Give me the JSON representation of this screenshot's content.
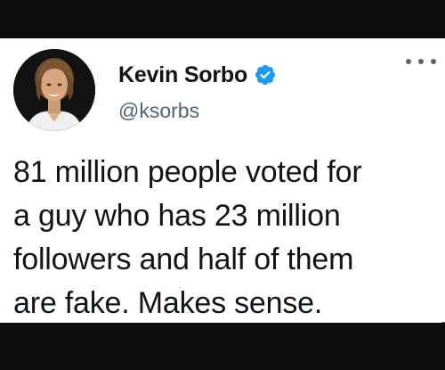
{
  "tweet": {
    "author": {
      "display_name": "Kevin Sorbo",
      "handle": "@ksorbs",
      "verified": true,
      "avatar_icon": "profile-photo"
    },
    "text_lines": [
      "81 million people voted for",
      "a guy who has 23 million",
      "followers and half of them",
      "are fake. Makes sense."
    ],
    "menu_icon": "more-options-icon"
  },
  "colors": {
    "verified_blue": "#1d9bf0",
    "text": "#0f1419",
    "secondary_text": "#536471",
    "card_background": "#ffffff",
    "frame": "#0d0d0d"
  }
}
